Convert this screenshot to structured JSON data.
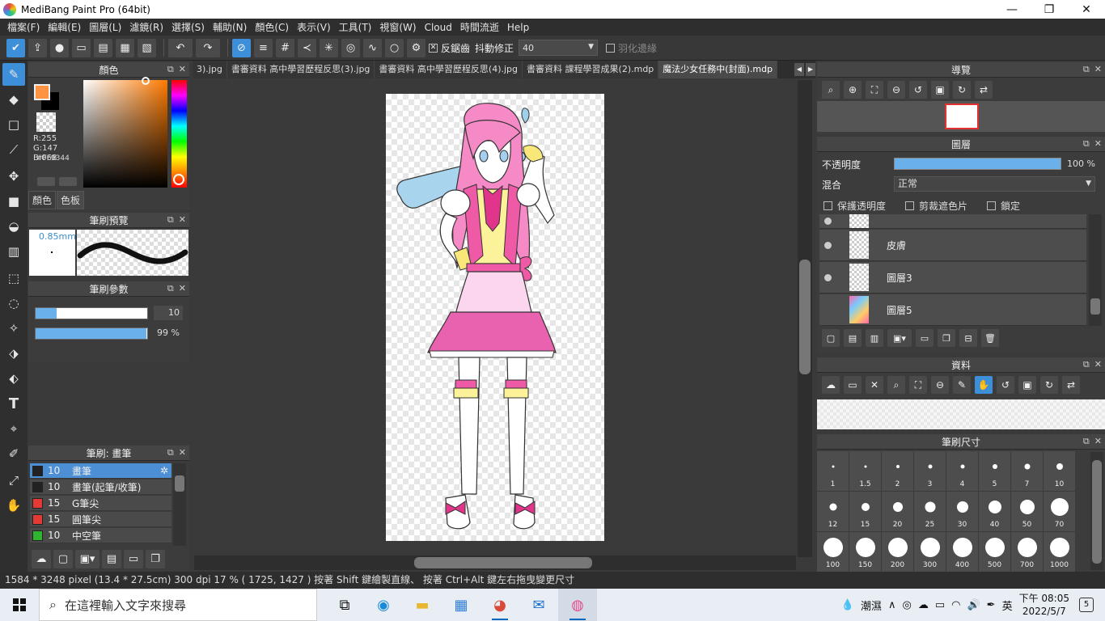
{
  "window": {
    "title": "MediBang Paint Pro (64bit)",
    "minimize": "—",
    "restore": "❐",
    "close": "✕"
  },
  "menu": [
    "檔案(F)",
    "編輯(E)",
    "圖層(L)",
    "濾鏡(R)",
    "選擇(S)",
    "輔助(N)",
    "顏色(C)",
    "表示(V)",
    "工具(T)",
    "視窗(W)",
    "Cloud",
    "時間流逝",
    "Help"
  ],
  "toolbar": {
    "antialias_label": "反鋸齒",
    "stabilizer_label": "抖動修正",
    "stabilizer_value": "40",
    "feather_label": "羽化邊緣"
  },
  "panels": {
    "color": {
      "title": "顏色",
      "r": "R:255",
      "g": "G:147",
      "b": "B:068",
      "hex": "#FF9344",
      "tab_color": "顏色",
      "tab_palette": "色板",
      "fg_color": "#ff9344"
    },
    "brush_preview": {
      "title": "筆刷預覽",
      "size": "0.85mm"
    },
    "brush_params": {
      "title": "筆刷參數",
      "size_value": "10",
      "size_fraction": 0.19,
      "opacity_value": "99 %",
      "opacity_fraction": 0.99
    },
    "brush_list": {
      "title": "筆刷: 畫筆",
      "items": [
        {
          "num": "10",
          "name": "畫筆",
          "color": "#222222",
          "active": true
        },
        {
          "num": "10",
          "name": "畫筆(起筆/收筆)",
          "color": "#222222",
          "active": false
        },
        {
          "num": "15",
          "name": "G筆尖",
          "color": "#e53935",
          "active": false
        },
        {
          "num": "15",
          "name": "圓筆尖",
          "color": "#e53935",
          "active": false
        },
        {
          "num": "10",
          "name": "中空筆",
          "color": "#2db52d",
          "active": false
        }
      ]
    },
    "navigator": {
      "title": "導覽"
    },
    "layers": {
      "title": "圖層",
      "opacity_label": "不透明度",
      "opacity_value": "100 %",
      "blend_label": "混合",
      "blend_value": "正常",
      "protect_alpha": "保護透明度",
      "clipping": "剪裁遮色片",
      "lock": "鎖定",
      "items": [
        {
          "name": "皮膚",
          "visible": true
        },
        {
          "name": "圖層3",
          "visible": true
        },
        {
          "name": "圖層5",
          "visible": false
        }
      ]
    },
    "material": {
      "title": "資料"
    },
    "brush_size": {
      "title": "筆刷尺寸",
      "sizes": [
        "1",
        "1.5",
        "2",
        "3",
        "4",
        "5",
        "7",
        "10",
        "12",
        "15",
        "20",
        "25",
        "30",
        "40",
        "50",
        "70",
        "100",
        "150",
        "200",
        "300",
        "400",
        "500",
        "700",
        "1000"
      ]
    }
  },
  "doc_tabs": [
    "3).jpg",
    "書審資料 高中學習歷程反思(3).jpg",
    "書審資料 高中學習歷程反思(4).jpg",
    "書審資料 課程學習成果(2).mdp",
    "魔法少女任務中(封面).mdp"
  ],
  "status": "1584 * 3248 pixel   (13.4 * 27.5cm)   300 dpi   17 %   ( 1725, 1427 )   按著 Shift 鍵繪製直線、 按著 Ctrl+Alt 鍵左右拖曳變更尺寸",
  "taskbar": {
    "search_placeholder": "在這裡輸入文字來搜尋",
    "weather": "潮濕",
    "ime": "英",
    "time": "下午 08:05",
    "date": "2022/5/7",
    "notifications": "5"
  }
}
